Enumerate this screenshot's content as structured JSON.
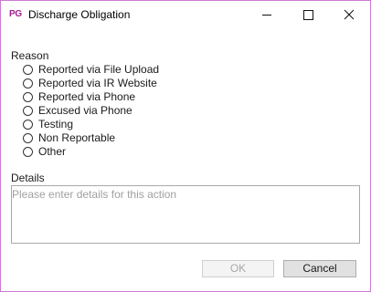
{
  "window": {
    "app_badge": "PG",
    "title": "Discharge Obligation",
    "accent_color": "#c97bd1",
    "badge_color": "#a01f8e"
  },
  "reason": {
    "label": "Reason",
    "options": [
      {
        "label": "Reported via File Upload",
        "selected": false
      },
      {
        "label": "Reported via IR Website",
        "selected": false
      },
      {
        "label": "Reported via Phone",
        "selected": false
      },
      {
        "label": "Excused via Phone",
        "selected": false
      },
      {
        "label": "Testing",
        "selected": false
      },
      {
        "label": "Non Reportable",
        "selected": false
      },
      {
        "label": "Other",
        "selected": false
      }
    ]
  },
  "details": {
    "label": "Details",
    "value": "",
    "placeholder": "Please enter details for this action"
  },
  "actions": {
    "ok_label": "OK",
    "ok_enabled": false,
    "cancel_label": "Cancel"
  }
}
